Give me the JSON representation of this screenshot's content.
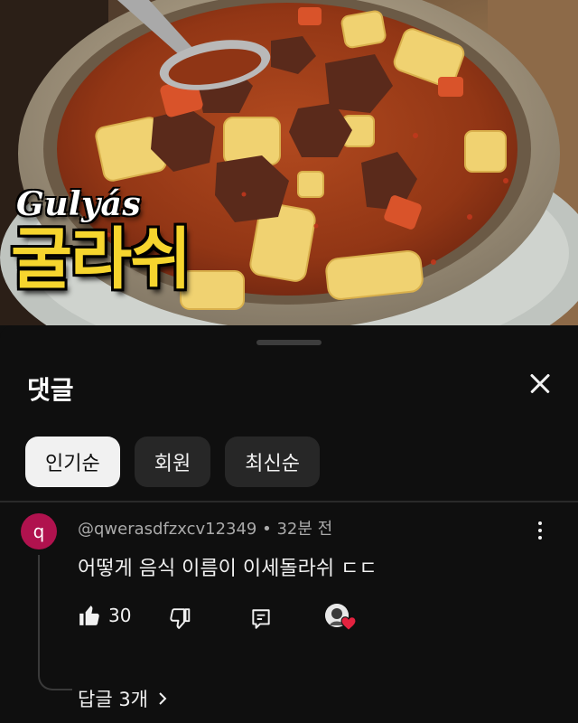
{
  "thumbnail": {
    "title_latin": "Gulyás",
    "title_korean": "굴라쉬"
  },
  "comments_panel": {
    "title": "댓글",
    "close_icon": "close-icon",
    "sort_chips": [
      {
        "label": "인기순",
        "selected": true
      },
      {
        "label": "회원",
        "selected": false
      },
      {
        "label": "최신순",
        "selected": false
      }
    ]
  },
  "comment": {
    "avatar_letter": "q",
    "avatar_color": "#b0124e",
    "meta": "@qwerasdfzxcv12349 • 32분 전",
    "text": "어떻게 음식 이름이 이세돌라쉬 ㄷㄷ",
    "like_count": "30",
    "icons": [
      "thumbs-up-icon",
      "thumbs-down-icon",
      "reply-icon",
      "creator-heart-icon",
      "more-vert-icon"
    ],
    "replies_label": "답글 3개"
  },
  "colors": {
    "background": "#0f0f0f",
    "chip_bg": "#272727",
    "chip_selected_bg": "#f1f1f1",
    "korean_title": "#f6d52e",
    "heart": "#e3223f"
  }
}
